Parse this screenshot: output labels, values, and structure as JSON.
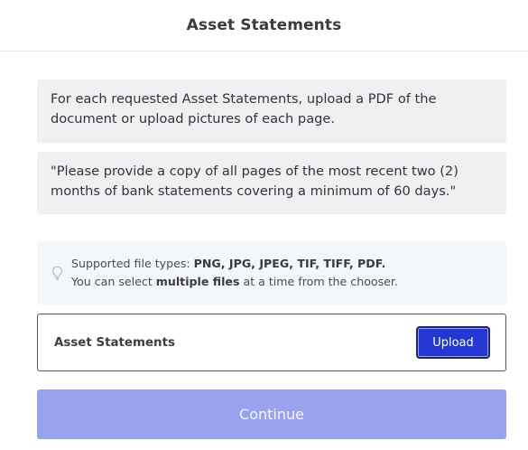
{
  "header": {
    "title": "Asset Statements"
  },
  "instructions": {
    "line1": "For each requested Asset Statements, upload a PDF of the",
    "line2": "document or upload pictures of each page."
  },
  "request": {
    "line1": "\"Please provide a copy of all pages of the most recent two (2)",
    "line2": "months of bank statements covering a minimum of 60 days.\""
  },
  "hint": {
    "icon": "lightbulb-icon",
    "prefix": "Supported file types: ",
    "types": "PNG, JPG, JPEG, TIF, TIFF, PDF.",
    "select_prefix": "You can select ",
    "select_bold": "multiple files",
    "select_suffix": " at a time from the chooser."
  },
  "upload": {
    "label": "Asset Statements",
    "button_label": "Upload"
  },
  "continue": {
    "label": "Continue"
  },
  "colors": {
    "accent": "#2437d2",
    "continue_disabled": "#98a2ee"
  }
}
